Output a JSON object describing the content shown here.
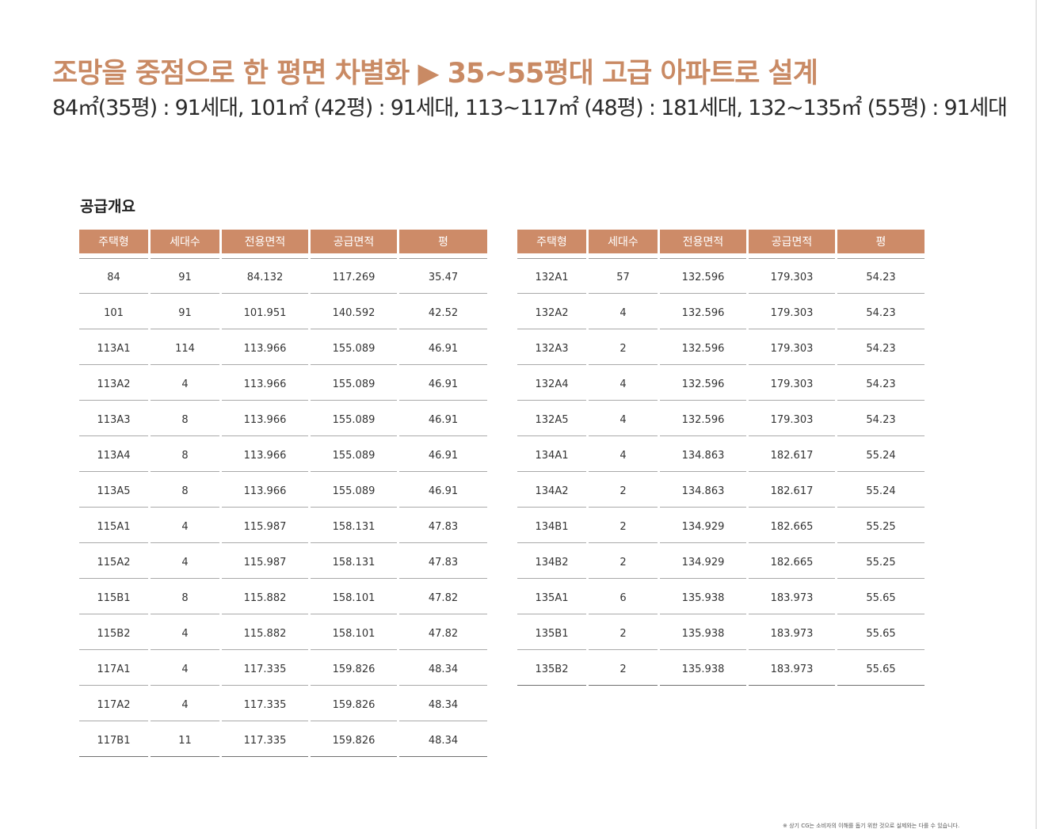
{
  "headline": "조망을 중점으로 한 평면 차별화 ▶ 35~55평대 고급 아파트로 설계",
  "subline": "84㎡(35평) : 91세대, 101㎡ (42평) : 91세대, 113~117㎡ (48평) : 181세대, 132~135㎡ (55평) : 91세대",
  "section_title": "공급개요",
  "columns": [
    "주택형",
    "세대수",
    "전용면적",
    "공급면적",
    "평"
  ],
  "left_table": [
    [
      "84",
      "91",
      "84.132",
      "117.269",
      "35.47"
    ],
    [
      "101",
      "91",
      "101.951",
      "140.592",
      "42.52"
    ],
    [
      "113A1",
      "114",
      "113.966",
      "155.089",
      "46.91"
    ],
    [
      "113A2",
      "4",
      "113.966",
      "155.089",
      "46.91"
    ],
    [
      "113A3",
      "8",
      "113.966",
      "155.089",
      "46.91"
    ],
    [
      "113A4",
      "8",
      "113.966",
      "155.089",
      "46.91"
    ],
    [
      "113A5",
      "8",
      "113.966",
      "155.089",
      "46.91"
    ],
    [
      "115A1",
      "4",
      "115.987",
      "158.131",
      "47.83"
    ],
    [
      "115A2",
      "4",
      "115.987",
      "158.131",
      "47.83"
    ],
    [
      "115B1",
      "8",
      "115.882",
      "158.101",
      "47.82"
    ],
    [
      "115B2",
      "4",
      "115.882",
      "158.101",
      "47.82"
    ],
    [
      "117A1",
      "4",
      "117.335",
      "159.826",
      "48.34"
    ],
    [
      "117A2",
      "4",
      "117.335",
      "159.826",
      "48.34"
    ],
    [
      "117B1",
      "11",
      "117.335",
      "159.826",
      "48.34"
    ]
  ],
  "right_table": [
    [
      "132A1",
      "57",
      "132.596",
      "179.303",
      "54.23"
    ],
    [
      "132A2",
      "4",
      "132.596",
      "179.303",
      "54.23"
    ],
    [
      "132A3",
      "2",
      "132.596",
      "179.303",
      "54.23"
    ],
    [
      "132A4",
      "4",
      "132.596",
      "179.303",
      "54.23"
    ],
    [
      "132A5",
      "4",
      "132.596",
      "179.303",
      "54.23"
    ],
    [
      "134A1",
      "4",
      "134.863",
      "182.617",
      "55.24"
    ],
    [
      "134A2",
      "2",
      "134.863",
      "182.617",
      "55.24"
    ],
    [
      "134B1",
      "2",
      "134.929",
      "182.665",
      "55.25"
    ],
    [
      "134B2",
      "2",
      "134.929",
      "182.665",
      "55.25"
    ],
    [
      "135A1",
      "6",
      "135.938",
      "183.973",
      "55.65"
    ],
    [
      "135B1",
      "2",
      "135.938",
      "183.973",
      "55.65"
    ],
    [
      "135B2",
      "2",
      "135.938",
      "183.973",
      "55.65"
    ]
  ],
  "footnote": "※ 상기 CG는 소비자의 이해를 돕기 위한 것으로 실제와는 다를 수 있습니다.",
  "colors": {
    "accent": "#c98a64",
    "header_bg": "#cd8b68"
  }
}
